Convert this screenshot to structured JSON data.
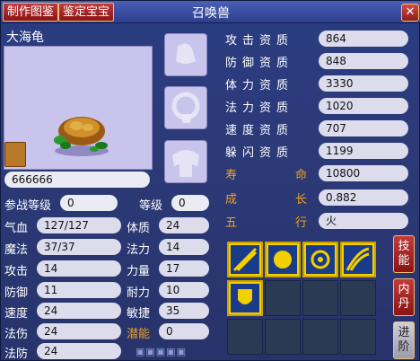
{
  "window": {
    "title": "召唤兽"
  },
  "top_buttons": {
    "catalog": "制作图鉴",
    "appraise": "鉴定宝宝"
  },
  "pet": {
    "name": "大海龟",
    "id_value": "666666"
  },
  "stats_left": {
    "battle_level": {
      "label": "参战等级",
      "value": "0"
    },
    "level": {
      "label": "等级",
      "value": "0"
    },
    "hp": {
      "label": "气血",
      "value": "127/127"
    },
    "mp": {
      "label": "魔法",
      "value": "37/37"
    },
    "attack": {
      "label": "攻击",
      "value": "14"
    },
    "defense": {
      "label": "防御",
      "value": "11"
    },
    "speed": {
      "label": "速度",
      "value": "24"
    },
    "magic_dmg": {
      "label": "法伤",
      "value": "24"
    },
    "magic_def": {
      "label": "法防",
      "value": "24"
    },
    "constitution": {
      "label": "体质",
      "value": "24"
    },
    "magic_power": {
      "label": "法力",
      "value": "14"
    },
    "strength": {
      "label": "力量",
      "value": "17"
    },
    "endurance": {
      "label": "耐力",
      "value": "10"
    },
    "agility": {
      "label": "敏捷",
      "value": "35"
    },
    "potential": {
      "label": "潜能",
      "value": "0"
    }
  },
  "aptitudes": [
    {
      "label": "攻击资质",
      "value": "864"
    },
    {
      "label": "防御资质",
      "value": "848"
    },
    {
      "label": "体力资质",
      "value": "3330"
    },
    {
      "label": "法力资质",
      "value": "1020"
    },
    {
      "label": "速度资质",
      "value": "707"
    },
    {
      "label": "躲闪资质",
      "value": "1199"
    }
  ],
  "special": {
    "lifespan": {
      "label_a": "寿",
      "label_b": "命",
      "value": "10800"
    },
    "growth": {
      "label_a": "成",
      "label_b": "长",
      "value": "0.882"
    },
    "element": {
      "label_a": "五",
      "label_b": "行",
      "value": "火"
    }
  },
  "side_tabs": {
    "skills": "技能",
    "inner": "内丹",
    "advance": "进阶"
  },
  "colors": {
    "accent_red": "#b02a2a",
    "skill_gold": "#f2d000",
    "orange_label": "#f0a020",
    "panel_bg": "#2c3a78"
  }
}
